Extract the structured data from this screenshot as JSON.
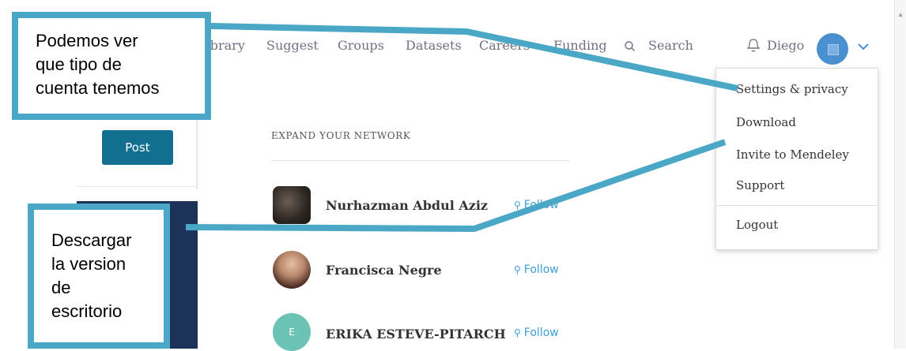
{
  "nav": {
    "items": [
      "Library",
      "Suggest",
      "Groups",
      "Datasets",
      "Careers",
      "Funding"
    ],
    "search_label": "Search",
    "user_name": "Diego"
  },
  "left_col": {
    "post_label": "Post"
  },
  "network": {
    "heading": "EXPAND YOUR NETWORK",
    "people": [
      {
        "name": "Nurhazman Abdul Aziz",
        "action": "Follow"
      },
      {
        "name": "Francisca Negre",
        "action": "Follow"
      },
      {
        "name": "ERIKA ESTEVE-PITARCH",
        "action": "Follow",
        "initial": "E"
      }
    ]
  },
  "user_menu": {
    "items": [
      "Settings & privacy",
      "Download",
      "Invite to Mendeley",
      "Support"
    ],
    "logout": "Logout"
  },
  "callouts": {
    "account_type": [
      "Podemos ver",
      "que tipo de",
      "cuenta tenemos"
    ],
    "download_desktop": [
      "Descargar",
      "la version",
      "de",
      "escritorio"
    ]
  },
  "colors": {
    "accent": "#4aa8c6",
    "post_button": "#126f8f",
    "follow": "#3a9fd6",
    "panel": "#1d3259"
  }
}
